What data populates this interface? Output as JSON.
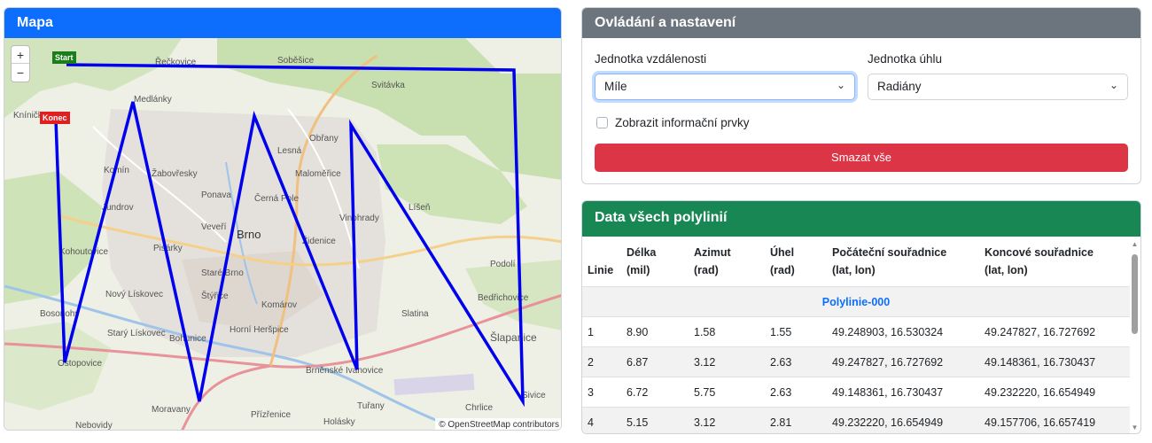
{
  "map": {
    "title": "Mapa",
    "zoom_in": "+",
    "zoom_out": "−",
    "start_label": "Start",
    "end_label": "Konec",
    "attribution": "© OpenStreetMap contributors",
    "place_labels": [
      "Řečkovice",
      "Soběšice",
      "Medlánky",
      "Obřany",
      "Komín",
      "Žabovřesky",
      "Lesná",
      "Maloměřice",
      "Ponava",
      "Černá Pole",
      "Jundrov",
      "Veveří",
      "Vinohrady",
      "Líšeň",
      "Kohoutovice",
      "Pisárky",
      "Brno",
      "Židenice",
      "Nový Lískovec",
      "Staré Brno",
      "Štýřice",
      "Komárov",
      "Bosonohy",
      "Bohunice",
      "Horní Heršpice",
      "Slatina",
      "Starý Lískovec",
      "Brněnské Ivanovice",
      "Šlapanice",
      "Ostopovice",
      "Tuřany",
      "Moravany",
      "Přízřenice",
      "Holásky",
      "Nebovidy",
      "Chrlice",
      "Kníničky",
      "Bedřichovice",
      "Podolí",
      "Sivice",
      "Svitávka"
    ]
  },
  "controls": {
    "title": "Ovládání a nastavení",
    "distance_label": "Jednotka vzdálenosti",
    "distance_value": "Míle",
    "angle_label": "Jednotka úhlu",
    "angle_value": "Radiány",
    "checkbox_label": "Zobrazit informační prvky",
    "clear_button": "Smazat vše"
  },
  "data": {
    "title": "Data všech polylinií",
    "columns": {
      "line": "Linie",
      "length": "Délka",
      "length_unit": "(mil)",
      "azimuth": "Azimut",
      "azimuth_unit": "(rad)",
      "angle": "Úhel",
      "angle_unit": "(rad)",
      "start": "Počáteční souřadnice",
      "start_unit": "(lat, lon)",
      "end": "Koncové souřadnice",
      "end_unit": "(lat, lon)"
    },
    "group": "Polylinie-000",
    "rows": [
      {
        "line": "1",
        "length": "8.90",
        "azimuth": "1.58",
        "angle": "1.55",
        "start": "49.248903, 16.530324",
        "end": "49.247827, 16.727692"
      },
      {
        "line": "2",
        "length": "6.87",
        "azimuth": "3.12",
        "angle": "2.63",
        "start": "49.247827, 16.727692",
        "end": "49.148361, 16.730437"
      },
      {
        "line": "3",
        "length": "6.72",
        "azimuth": "5.75",
        "angle": "2.63",
        "start": "49.148361, 16.730437",
        "end": "49.232220, 16.654949"
      },
      {
        "line": "4",
        "length": "5.15",
        "azimuth": "3.12",
        "angle": "2.81",
        "start": "49.232220, 16.654949",
        "end": "49.157706, 16.657419"
      }
    ]
  },
  "colors": {
    "map_header": "#0d6efd",
    "controls_header": "#6c757d",
    "data_header": "#198754",
    "danger": "#dc3545",
    "polyline": "#0000ee"
  }
}
